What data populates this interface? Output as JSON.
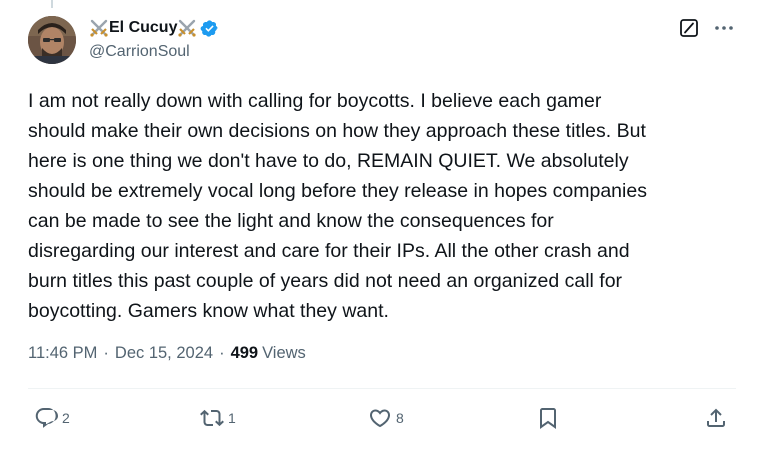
{
  "author": {
    "display_name": "El Cucuy",
    "handle": "@CarrionSoul",
    "verified": true,
    "name_decoration": "crossed-swords-emoji"
  },
  "tweet": {
    "text": "I am not really down with calling for boycotts. I believe each gamer\nshould make their own decisions on how they approach these titles. But\nhere is one thing we don't have to do, REMAIN QUIET. We absolutely\nshould be extremely vocal long before they release in hopes companies\ncan be made to see the light and know the consequences for\ndisregarding our interest and care for their IPs. All the other crash and\nburn titles this past couple of years did not need an organized call for\nboycotting. Gamers know what they want."
  },
  "meta": {
    "time": "11:46 PM",
    "separator": "·",
    "date": "Dec 15, 2024",
    "views_count": "499",
    "views_label": "Views"
  },
  "actions": {
    "replies": "2",
    "reposts": "1",
    "likes": "8"
  },
  "colors": {
    "text_primary": "#0f1419",
    "text_secondary": "#536471",
    "verified_blue": "#1d9bf0",
    "divider": "#eff3f4"
  }
}
